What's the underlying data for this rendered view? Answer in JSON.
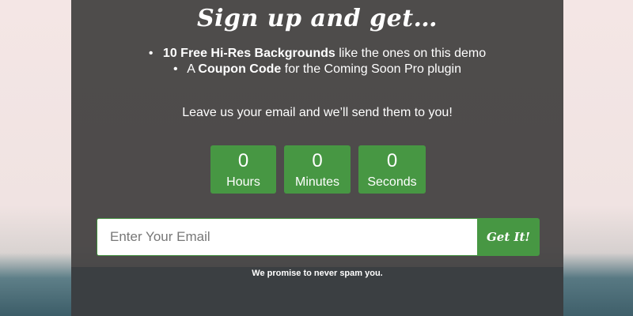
{
  "headline": {
    "text": "Sign up and get…"
  },
  "benefits": [
    {
      "bold": "10 Free Hi-Res Backgrounds",
      "text": " like the ones on this demo"
    },
    {
      "prefix": "A ",
      "bold": "Coupon Code",
      "text": " for the Coming Soon Pro plugin"
    }
  ],
  "lead": {
    "text": "Leave us your email and we’ll send them to you!"
  },
  "countdown": [
    {
      "value": "0",
      "label": "Hours"
    },
    {
      "value": "0",
      "label": "Minutes"
    },
    {
      "value": "0",
      "label": "Seconds"
    }
  ],
  "form": {
    "email_placeholder": "Enter Your Email",
    "email_value": "",
    "submit_label": "Get It!"
  },
  "footer": {
    "promise_text": "We promise to never spam you."
  },
  "colors": {
    "panel": "#484646",
    "accent": "#479743",
    "text": "#ffffff"
  }
}
